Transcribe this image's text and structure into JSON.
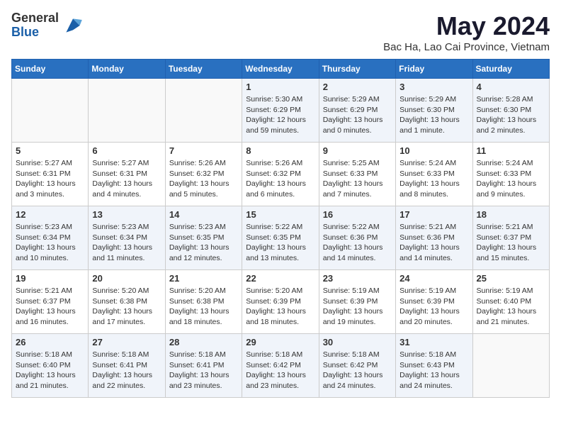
{
  "header": {
    "logo_general": "General",
    "logo_blue": "Blue",
    "title": "May 2024",
    "subtitle": "Bac Ha, Lao Cai Province, Vietnam"
  },
  "calendar": {
    "days_of_week": [
      "Sunday",
      "Monday",
      "Tuesday",
      "Wednesday",
      "Thursday",
      "Friday",
      "Saturday"
    ],
    "weeks": [
      [
        {
          "day": "",
          "info": ""
        },
        {
          "day": "",
          "info": ""
        },
        {
          "day": "",
          "info": ""
        },
        {
          "day": "1",
          "info": "Sunrise: 5:30 AM\nSunset: 6:29 PM\nDaylight: 12 hours\nand 59 minutes."
        },
        {
          "day": "2",
          "info": "Sunrise: 5:29 AM\nSunset: 6:29 PM\nDaylight: 13 hours\nand 0 minutes."
        },
        {
          "day": "3",
          "info": "Sunrise: 5:29 AM\nSunset: 6:30 PM\nDaylight: 13 hours\nand 1 minute."
        },
        {
          "day": "4",
          "info": "Sunrise: 5:28 AM\nSunset: 6:30 PM\nDaylight: 13 hours\nand 2 minutes."
        }
      ],
      [
        {
          "day": "5",
          "info": "Sunrise: 5:27 AM\nSunset: 6:31 PM\nDaylight: 13 hours\nand 3 minutes."
        },
        {
          "day": "6",
          "info": "Sunrise: 5:27 AM\nSunset: 6:31 PM\nDaylight: 13 hours\nand 4 minutes."
        },
        {
          "day": "7",
          "info": "Sunrise: 5:26 AM\nSunset: 6:32 PM\nDaylight: 13 hours\nand 5 minutes."
        },
        {
          "day": "8",
          "info": "Sunrise: 5:26 AM\nSunset: 6:32 PM\nDaylight: 13 hours\nand 6 minutes."
        },
        {
          "day": "9",
          "info": "Sunrise: 5:25 AM\nSunset: 6:33 PM\nDaylight: 13 hours\nand 7 minutes."
        },
        {
          "day": "10",
          "info": "Sunrise: 5:24 AM\nSunset: 6:33 PM\nDaylight: 13 hours\nand 8 minutes."
        },
        {
          "day": "11",
          "info": "Sunrise: 5:24 AM\nSunset: 6:33 PM\nDaylight: 13 hours\nand 9 minutes."
        }
      ],
      [
        {
          "day": "12",
          "info": "Sunrise: 5:23 AM\nSunset: 6:34 PM\nDaylight: 13 hours\nand 10 minutes."
        },
        {
          "day": "13",
          "info": "Sunrise: 5:23 AM\nSunset: 6:34 PM\nDaylight: 13 hours\nand 11 minutes."
        },
        {
          "day": "14",
          "info": "Sunrise: 5:23 AM\nSunset: 6:35 PM\nDaylight: 13 hours\nand 12 minutes."
        },
        {
          "day": "15",
          "info": "Sunrise: 5:22 AM\nSunset: 6:35 PM\nDaylight: 13 hours\nand 13 minutes."
        },
        {
          "day": "16",
          "info": "Sunrise: 5:22 AM\nSunset: 6:36 PM\nDaylight: 13 hours\nand 14 minutes."
        },
        {
          "day": "17",
          "info": "Sunrise: 5:21 AM\nSunset: 6:36 PM\nDaylight: 13 hours\nand 14 minutes."
        },
        {
          "day": "18",
          "info": "Sunrise: 5:21 AM\nSunset: 6:37 PM\nDaylight: 13 hours\nand 15 minutes."
        }
      ],
      [
        {
          "day": "19",
          "info": "Sunrise: 5:21 AM\nSunset: 6:37 PM\nDaylight: 13 hours\nand 16 minutes."
        },
        {
          "day": "20",
          "info": "Sunrise: 5:20 AM\nSunset: 6:38 PM\nDaylight: 13 hours\nand 17 minutes."
        },
        {
          "day": "21",
          "info": "Sunrise: 5:20 AM\nSunset: 6:38 PM\nDaylight: 13 hours\nand 18 minutes."
        },
        {
          "day": "22",
          "info": "Sunrise: 5:20 AM\nSunset: 6:39 PM\nDaylight: 13 hours\nand 18 minutes."
        },
        {
          "day": "23",
          "info": "Sunrise: 5:19 AM\nSunset: 6:39 PM\nDaylight: 13 hours\nand 19 minutes."
        },
        {
          "day": "24",
          "info": "Sunrise: 5:19 AM\nSunset: 6:39 PM\nDaylight: 13 hours\nand 20 minutes."
        },
        {
          "day": "25",
          "info": "Sunrise: 5:19 AM\nSunset: 6:40 PM\nDaylight: 13 hours\nand 21 minutes."
        }
      ],
      [
        {
          "day": "26",
          "info": "Sunrise: 5:18 AM\nSunset: 6:40 PM\nDaylight: 13 hours\nand 21 minutes."
        },
        {
          "day": "27",
          "info": "Sunrise: 5:18 AM\nSunset: 6:41 PM\nDaylight: 13 hours\nand 22 minutes."
        },
        {
          "day": "28",
          "info": "Sunrise: 5:18 AM\nSunset: 6:41 PM\nDaylight: 13 hours\nand 23 minutes."
        },
        {
          "day": "29",
          "info": "Sunrise: 5:18 AM\nSunset: 6:42 PM\nDaylight: 13 hours\nand 23 minutes."
        },
        {
          "day": "30",
          "info": "Sunrise: 5:18 AM\nSunset: 6:42 PM\nDaylight: 13 hours\nand 24 minutes."
        },
        {
          "day": "31",
          "info": "Sunrise: 5:18 AM\nSunset: 6:43 PM\nDaylight: 13 hours\nand 24 minutes."
        },
        {
          "day": "",
          "info": ""
        }
      ]
    ]
  }
}
